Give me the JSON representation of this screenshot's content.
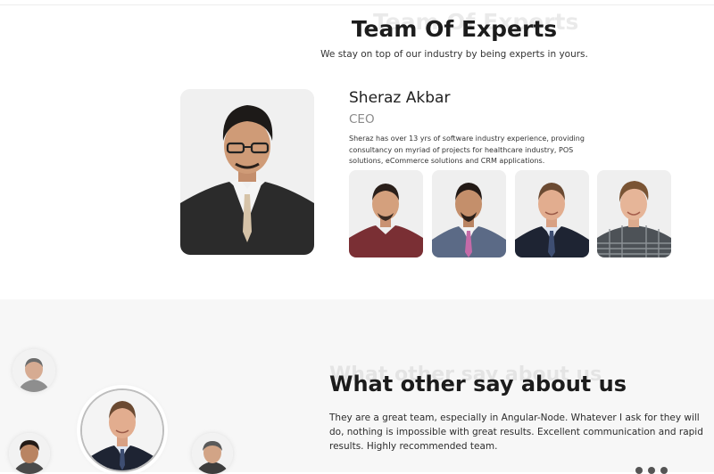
{
  "team": {
    "ghost_title": "Team Of Experts",
    "title": "Team Of Experts",
    "subtitle": "We stay on top of our industry by being experts in yours."
  },
  "expert": {
    "name": "Sheraz Akbar",
    "role": "CEO",
    "bio": "Sheraz has over 13 yrs of software industry experience, providing consultancy on myriad of projects for healthcare industry, POS solutions, eCommerce solutions and CRM applications.",
    "photo": "sheraz-akbar-photo"
  },
  "team_thumbnails": [
    {
      "name": "team-member-1"
    },
    {
      "name": "team-member-2"
    },
    {
      "name": "team-member-3"
    },
    {
      "name": "team-member-4"
    }
  ],
  "testimonials": {
    "ghost_title": "What other say about us",
    "title": "What other say about us",
    "quote": "They are a great team, especially in Angular-Node. Whatever I ask for they will do, nothing is impossible with great results. Excellent communication and rapid results. Highly recommended team.",
    "carousel_dots": 3
  },
  "colors": {
    "heading": "#1c1c1c",
    "muted": "#8a8a8a",
    "section_bg": "#f7f7f7"
  }
}
